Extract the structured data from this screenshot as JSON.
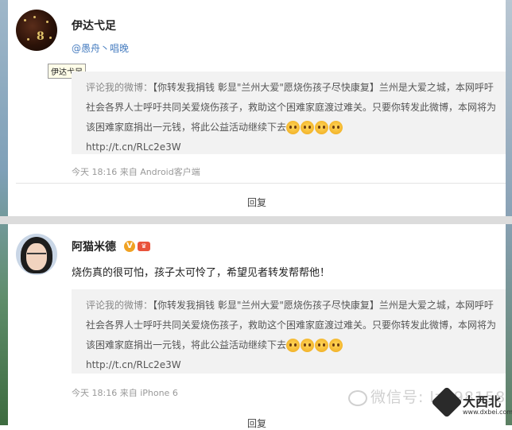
{
  "post1": {
    "username": "伊达弋足",
    "mentions": "@愚舟丶唱晚",
    "tooltip": "伊达弋足",
    "quote_label": "评论我的微博：",
    "quote_body": "【你转发我捐钱 彰显\"兰州大爱\"愿烧伤孩子尽快康复】兰州是大爱之城，本网呼吁社会各界人士呼吁共同关爱烧伤孩子，救助这个困难家庭渡过难关。只要你转发此微博，本网将为该困难家庭捐出一元钱，将此公益活动继续下去",
    "quote_link": "http://t.cn/RLc2e3W",
    "meta": "今天 18:16 来自 Android客户端",
    "reply_label": "回复"
  },
  "post2": {
    "username": "阿猫米德",
    "verified_badge": "V",
    "comment": "烧伤真的很可怕，孩子太可怜了，希望见者转发帮帮他！",
    "quote_label": "评论我的微博：",
    "quote_body": "【你转发我捐钱 彰显\"兰州大爱\"愿烧伤孩子尽快康复】兰州是大爱之城，本网呼吁社会各界人士呼吁共同关爱烧伤孩子，救助这个困难家庭渡过难关。只要你转发此微博，本网将为该困难家庭捐出一元钱，将此公益活动继续下去",
    "quote_link": "http://t.cn/RLc2e3W",
    "meta": "今天 18:16 来自 iPhone 6",
    "reply_label": "回复"
  },
  "watermark": "微信号: lz998158",
  "site_logo": {
    "name": "大西北",
    "url": "www.dxbei.com"
  },
  "colors": {
    "link": "#4a7fc1",
    "quote_bg": "#f2f2f2",
    "meta": "#999999"
  }
}
